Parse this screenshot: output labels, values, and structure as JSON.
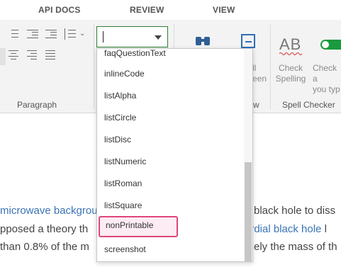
{
  "tabs": [
    {
      "label": "API DOCS"
    },
    {
      "label": "REVIEW"
    },
    {
      "label": "VIEW"
    }
  ],
  "ribbon": {
    "paragraph_group": {
      "label": "Paragraph"
    },
    "view_group": {
      "label": "View",
      "partial_label": "w",
      "fullscreen_label_line1": "ll",
      "fullscreen_label_line2": "een"
    },
    "spell_group": {
      "label": "Spell Checker",
      "check_spelling_line1": "Check",
      "check_spelling_line2": "Spelling",
      "check_as_type_line1": "Check a",
      "check_as_type_line2": "you typ",
      "ab_glyph": "AB"
    },
    "style_select": {
      "value": ""
    }
  },
  "dropdown": {
    "options": [
      {
        "label": "faqQuestionText"
      },
      {
        "label": "inlineCode"
      },
      {
        "label": "listAlpha"
      },
      {
        "label": "listCircle"
      },
      {
        "label": "listDisc"
      },
      {
        "label": "listNumeric"
      },
      {
        "label": "listRoman"
      },
      {
        "label": "listSquare"
      },
      {
        "label": "nonPrintable",
        "selected": true
      },
      {
        "label": "screenshot"
      }
    ]
  },
  "document": {
    "line1": {
      "a": "microwave backgrou",
      "b": "black hole to diss"
    },
    "line2": {
      "a": "pposed a theory th",
      "b": "ordial black hole",
      "c": " l"
    },
    "line3": {
      "a": "than 0.8% of the m",
      "b": "ely the mass of th"
    }
  },
  "colors": {
    "accent_green": "#2e7d32",
    "link_blue": "#3a73b5",
    "selected_border": "#e0457b",
    "selected_fill": "#fdecf3"
  }
}
